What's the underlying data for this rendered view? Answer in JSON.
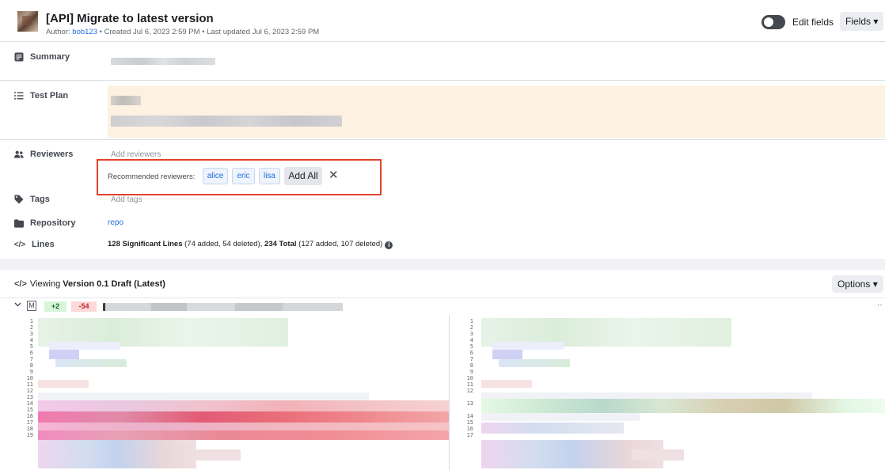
{
  "header": {
    "title": "[API] Migrate to latest version",
    "author_prefix": "Author: ",
    "author": "bob123",
    "meta_rest": " • Created Jul 6, 2023 2:59 PM • Last updated Jul 6, 2023 2:59 PM",
    "edit_fields_label": "Edit fields",
    "fields_label": "Fields ▾"
  },
  "fields": {
    "summary_label": "Summary",
    "test_plan_label": "Test Plan",
    "reviewers_label": "Reviewers",
    "reviewers_placeholder": "Add reviewers",
    "recommended_label": "Recommended reviewers:",
    "recommended": [
      "alice",
      "eric",
      "lisa"
    ],
    "add_all_label": "Add All",
    "dismiss_glyph": "✕",
    "tags_label": "Tags",
    "tags_placeholder": "Add tags",
    "repository_label": "Repository",
    "repository_value": "repo",
    "lines_label": "Lines",
    "lines": {
      "sig": "128 Significant Lines",
      "sig_detail": " (74 added, 54 deleted), ",
      "total": "234 Total",
      "total_detail": " (127 added, 107 deleted)"
    }
  },
  "viewer": {
    "viewing_prefix": "Viewing ",
    "version": "Version 0.1 Draft (Latest)",
    "options_label": "Options ▾",
    "file_status": "M",
    "added": "+2",
    "deleted": "-54",
    "left_line_numbers": [
      "1",
      "2",
      "3",
      "4",
      "5",
      "6",
      "7",
      "8",
      "9",
      "10",
      "11",
      "12",
      "13",
      "14",
      "15",
      "16",
      "17",
      "18",
      "19"
    ],
    "right_line_numbers": [
      "1",
      "2",
      "3",
      "4",
      "5",
      "6",
      "7",
      "8",
      "9",
      "10",
      "11",
      "12",
      "",
      "13",
      "",
      "14",
      "15",
      "16",
      "17"
    ]
  },
  "icons": {
    "summary": "summary-icon",
    "test_plan": "list-icon",
    "reviewers": "people-icon",
    "tags": "tag-icon",
    "repository": "folder-icon",
    "lines": "code-icon"
  },
  "colors": {
    "link": "#216fdb",
    "highlight_border": "#e0432c",
    "added_bg": "#d6f5d9",
    "deleted_bg": "#fcd8d8"
  }
}
